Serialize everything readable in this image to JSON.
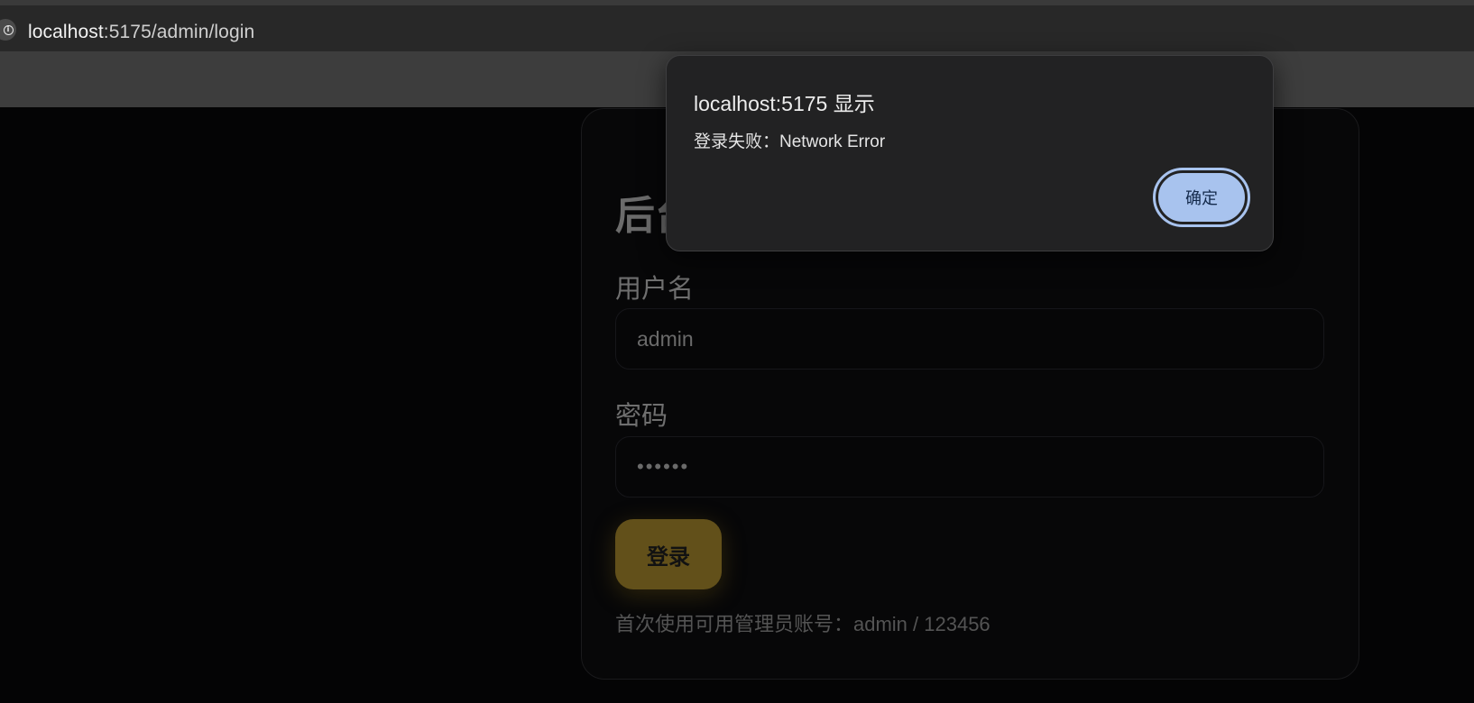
{
  "browser": {
    "url_host": "localhost",
    "url_rest": ":5175/admin/login"
  },
  "login_form": {
    "title": "后台登录",
    "username_label": "用户名",
    "username_value": "admin",
    "password_label": "密码",
    "password_value": "••••••",
    "submit_label": "登录",
    "hint": "首次使用可用管理员账号：admin / 123456"
  },
  "alert": {
    "title": "localhost:5175 显示",
    "message": "登录失败：Network Error",
    "ok_label": "确定"
  },
  "colors": {
    "page_bg": "#050506",
    "accent": "#62501a",
    "dialog_button": "#a8c3ee"
  }
}
